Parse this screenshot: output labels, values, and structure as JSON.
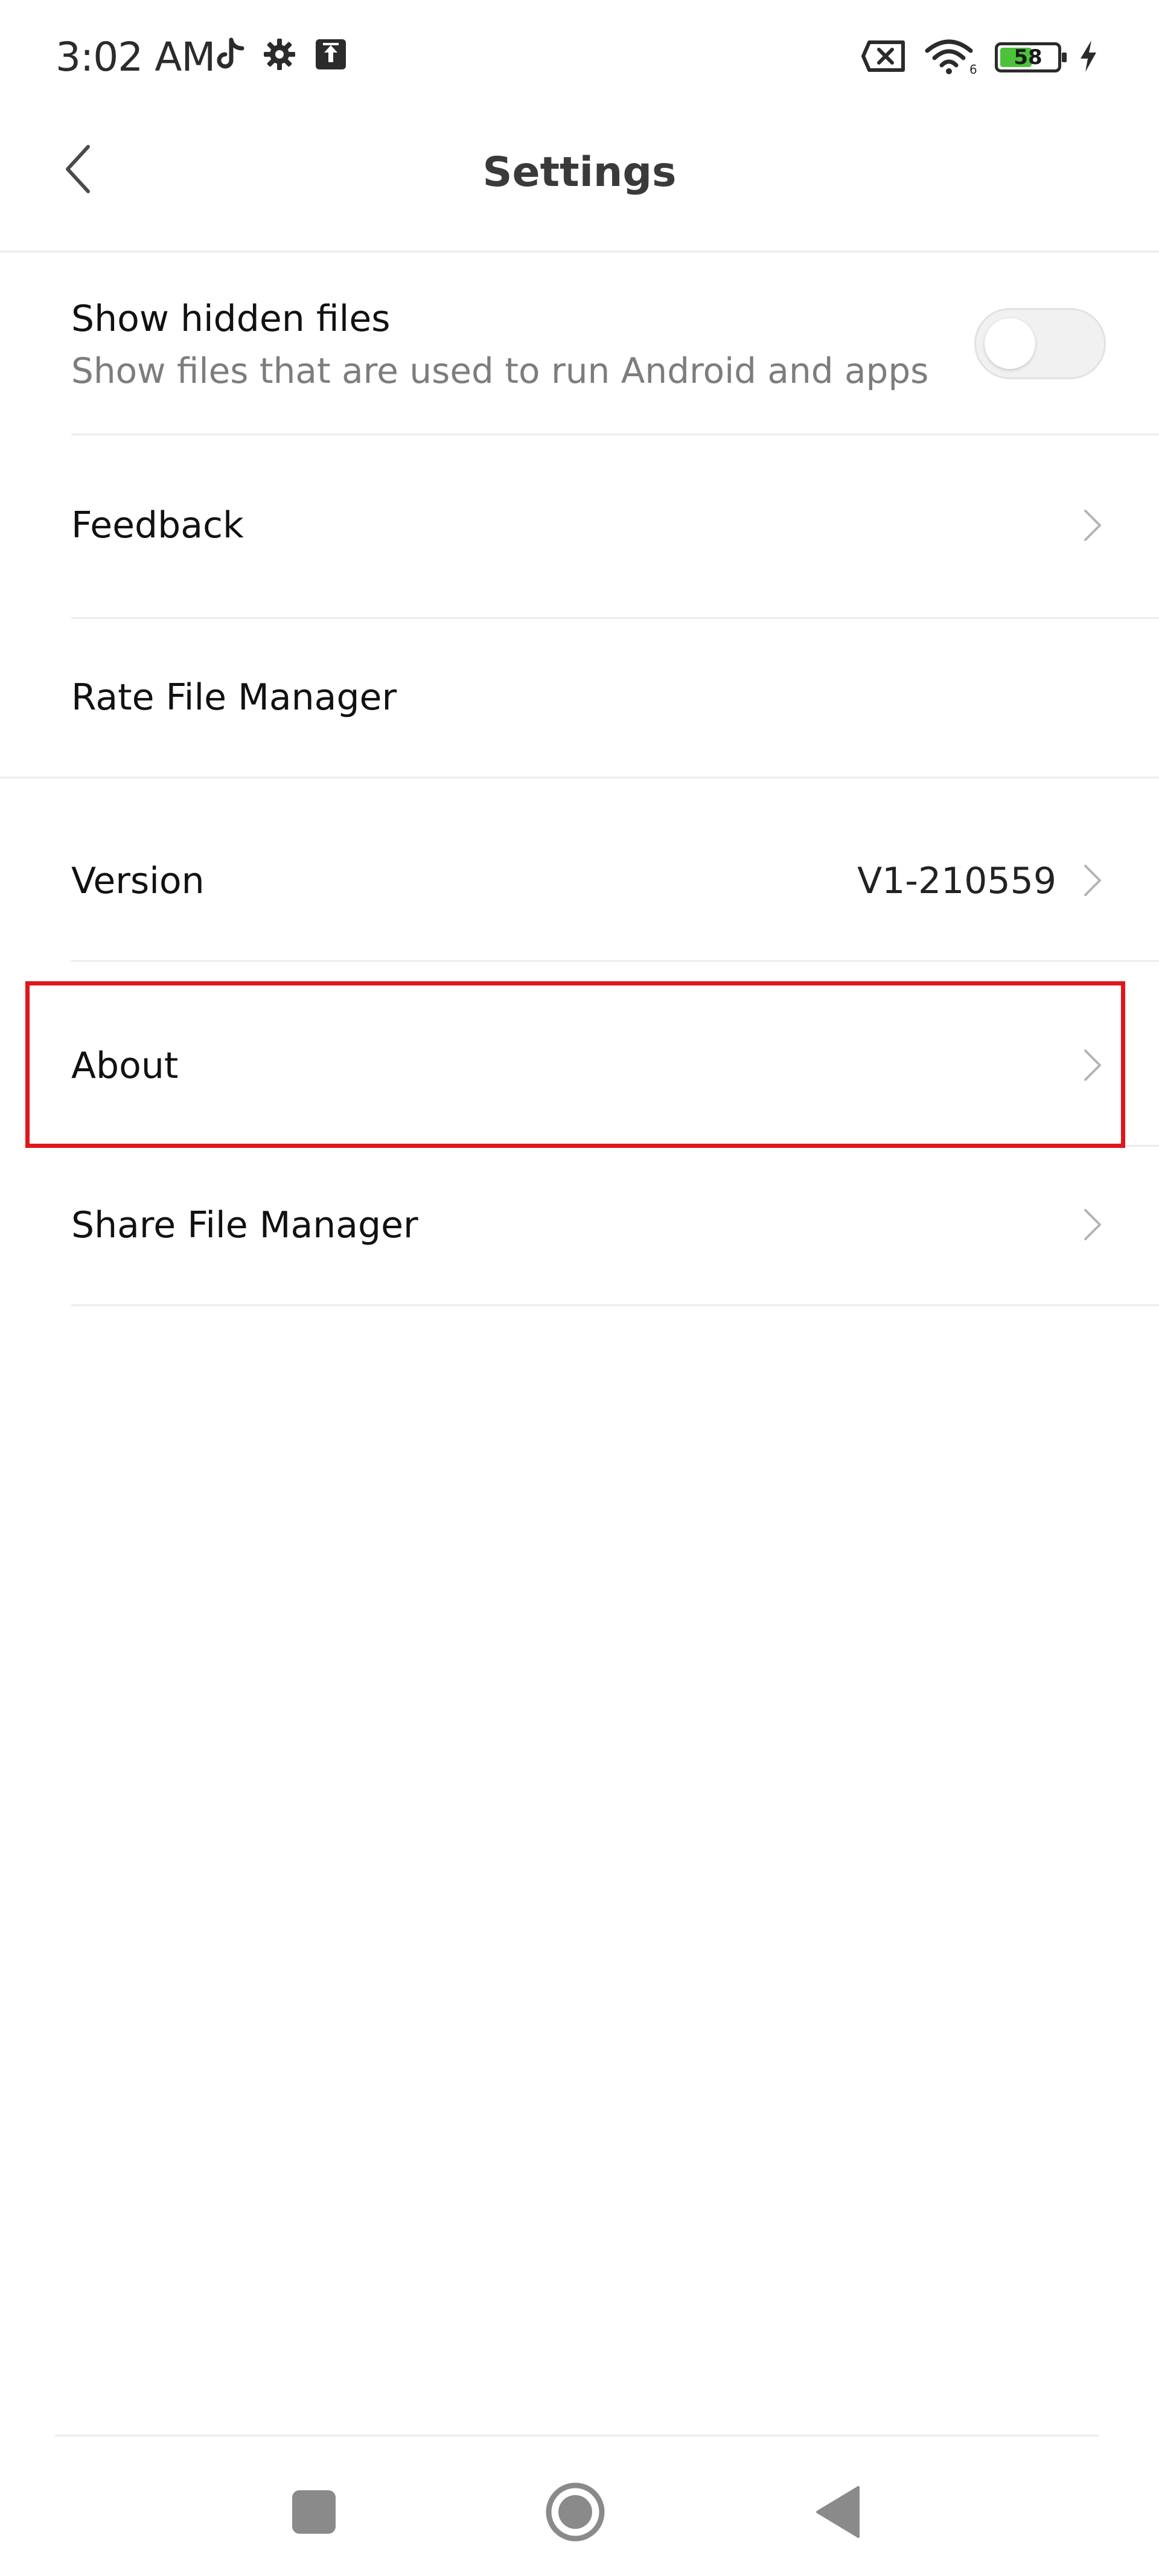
{
  "status_bar": {
    "time": "3:02 AM",
    "battery_level": "58",
    "left_icons": [
      "tiktok-icon",
      "gear-icon",
      "upload-icon"
    ],
    "right_icons": [
      "sim-disabled-icon",
      "wifi-icon",
      "battery-icon",
      "charging-icon"
    ]
  },
  "header": {
    "title": "Settings",
    "back_icon": "chevron-left-icon"
  },
  "settings": {
    "hidden_files": {
      "label": "Show hidden files",
      "subtitle": "Show files that are used to run Android and apps",
      "enabled": false
    },
    "feedback": {
      "label": "Feedback"
    },
    "rate": {
      "label": "Rate File Manager"
    },
    "version": {
      "label": "Version",
      "value": "V1-210559"
    },
    "about": {
      "label": "About"
    },
    "share": {
      "label": "Share File Manager"
    }
  },
  "colors": {
    "highlight": "#e0161b",
    "battery_fill": "#4cc23b",
    "divider": "#ececec",
    "subtitle": "#7d7d7d"
  },
  "nav_bar": {
    "icons": [
      "recents-square-icon",
      "home-circle-icon",
      "back-triangle-icon"
    ]
  }
}
